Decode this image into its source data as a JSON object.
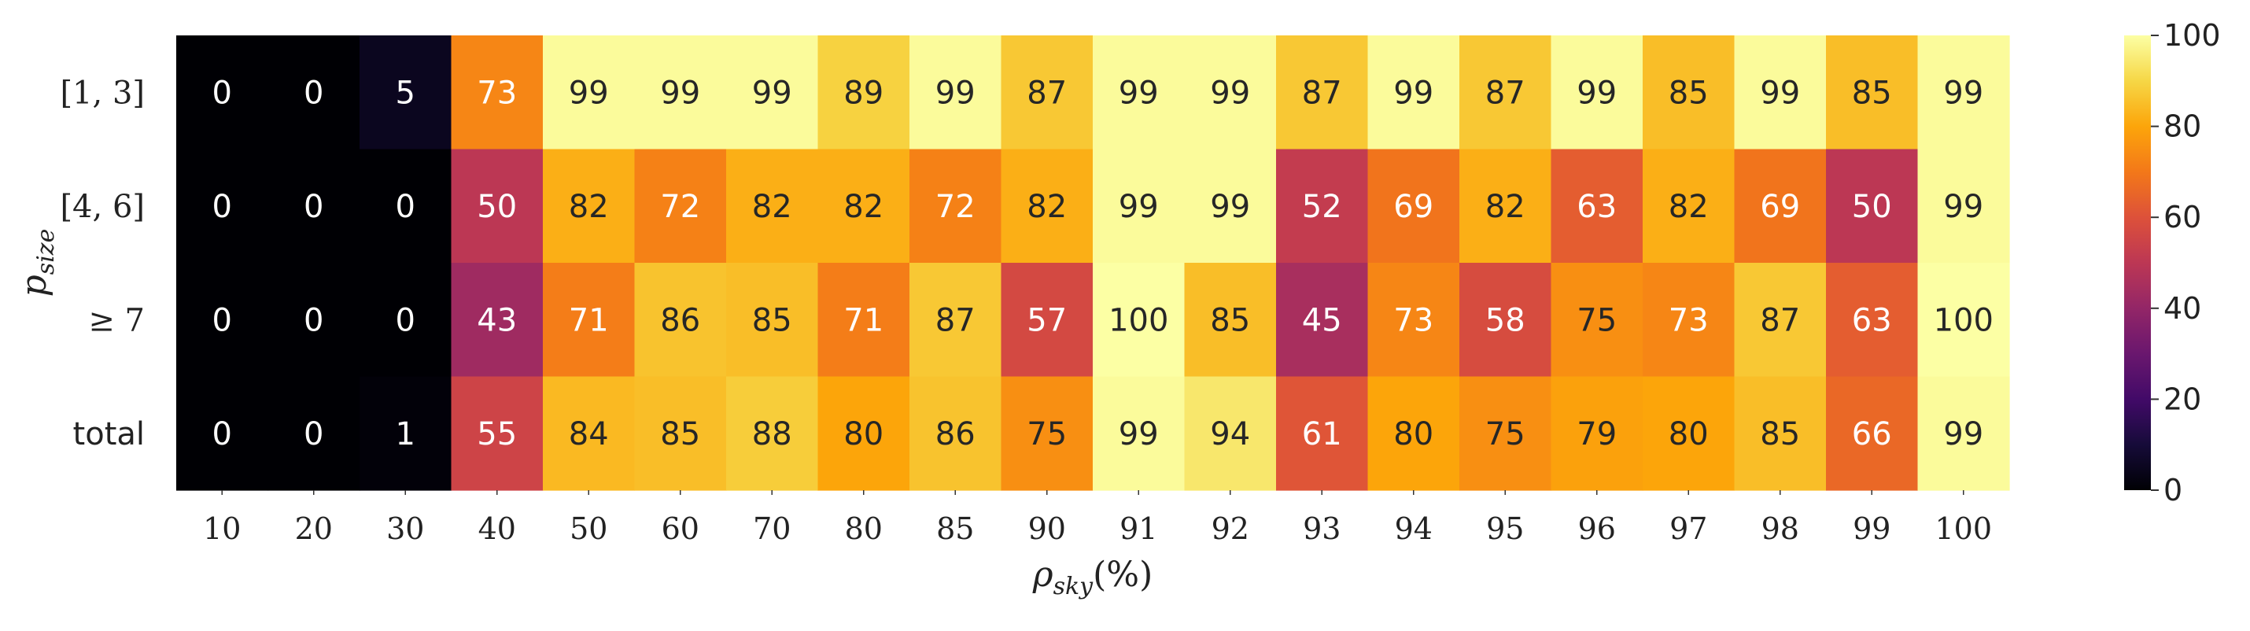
{
  "chart_data": {
    "type": "heatmap",
    "colormap": "inferno",
    "x_axis_label": "ρsky(%)",
    "y_axis_label": "psize",
    "x_categories": [
      "10",
      "20",
      "30",
      "40",
      "50",
      "60",
      "70",
      "80",
      "85",
      "90",
      "91",
      "92",
      "93",
      "94",
      "95",
      "96",
      "97",
      "98",
      "99",
      "100"
    ],
    "y_categories": [
      "[1, 3]",
      "[4, 6]",
      "≥ 7",
      "total"
    ],
    "values": [
      [
        0,
        0,
        5,
        73,
        99,
        99,
        99,
        89,
        99,
        87,
        99,
        99,
        87,
        99,
        87,
        99,
        85,
        99,
        85,
        99
      ],
      [
        0,
        0,
        0,
        50,
        82,
        72,
        82,
        82,
        72,
        82,
        99,
        99,
        52,
        69,
        82,
        63,
        82,
        69,
        50,
        99
      ],
      [
        0,
        0,
        0,
        43,
        71,
        86,
        85,
        71,
        87,
        57,
        100,
        85,
        45,
        73,
        58,
        75,
        73,
        87,
        63,
        100
      ],
      [
        0,
        0,
        1,
        55,
        84,
        85,
        88,
        80,
        86,
        75,
        99,
        94,
        61,
        80,
        75,
        79,
        80,
        85,
        66,
        99
      ]
    ],
    "colorbar": {
      "range": [
        0,
        100
      ],
      "ticks": [
        "0",
        "20",
        "40",
        "60",
        "80",
        "100"
      ]
    }
  }
}
